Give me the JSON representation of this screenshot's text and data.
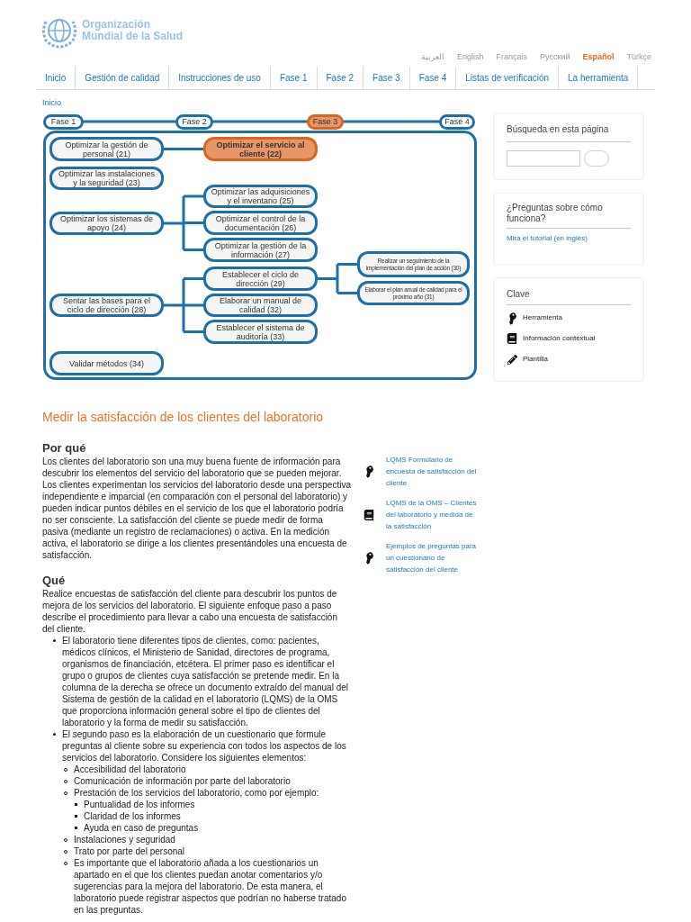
{
  "header": {
    "logo_text": [
      "Organización",
      "Mundial de la Salud"
    ],
    "languages": [
      {
        "label": "العربية",
        "selected": false
      },
      {
        "label": "English",
        "selected": false
      },
      {
        "label": "Français",
        "selected": false
      },
      {
        "label": "Русский",
        "selected": false
      },
      {
        "label": "Español",
        "selected": true
      },
      {
        "label": "Türkçe",
        "selected": false
      }
    ]
  },
  "nav": [
    "Inicio",
    "Gestión de calidad",
    "Instrucciones de uso",
    "Fase 1",
    "Fase 2",
    "Fase 3",
    "Fase 4",
    "Listas de verificación",
    "La herramienta"
  ],
  "breadcrumb": "Inicio",
  "diagram": {
    "phases": [
      {
        "label": "Fase 1",
        "selected": false
      },
      {
        "label": "Fase 2",
        "selected": false
      },
      {
        "label": "Fase 3",
        "selected": true
      },
      {
        "label": "Fase 4",
        "selected": false
      }
    ],
    "items": [
      {
        "label": "Optimizar la gestión de personal (21)",
        "selected": false,
        "children": [
          {
            "label": "Optimizar el servicio al cliente (22)",
            "selected": true
          }
        ]
      },
      {
        "label": "Optimizar las instalaciones y la seguridad (23)",
        "selected": false
      },
      {
        "label": "Optimizar los sistemas de apoyo (24)",
        "selected": false,
        "children": [
          {
            "label": "Optimizar las adquisiciones y el inventario (25)",
            "selected": false
          },
          {
            "label": "Optimizar el control de la documentación (26)",
            "selected": false
          },
          {
            "label": "Optimizar la gestión de la información (27)",
            "selected": false
          }
        ]
      },
      {
        "label": "Sentar las bases para el ciclo de dirección (28)",
        "selected": false,
        "children": [
          {
            "label": "Establecer el ciclo de dirección (29)",
            "selected": false,
            "children": [
              {
                "label": "Realizar un seguimiento de la implementación del plan de acción (30)",
                "selected": false
              },
              {
                "label": "Elaborar el plan anual de calidad para el próximo año (31)",
                "selected": false
              }
            ]
          },
          {
            "label": "Elaborar un manual de calidad (32)",
            "selected": false
          },
          {
            "label": "Establecer el sistema de auditoría (33)",
            "selected": false
          }
        ]
      },
      {
        "label": "Validar métodos (34)",
        "selected": false
      }
    ]
  },
  "title": "Medir la satisfacción de los clientes del laboratorio",
  "why": {
    "heading": "Por qué",
    "text": "Los clientes del laboratorio son una muy buena fuente de información para descubrir los elementos del servicio del laboratorio que se pueden mejorar. Los clientes experimentan los servicios del laboratorio desde una perspectiva independiente e imparcial (en comparación con el personal del laboratorio) y pueden indicar puntos débiles en el servicio de los que el laboratorio podría no ser consciente. La satisfacción del cliente se puede medir de forma pasiva (mediante un registro de reclamaciones) o activa. En la medición activa, el laboratorio se dirige a los clientes presentándoles una encuesta de satisfacción."
  },
  "what": {
    "heading": "Qué",
    "text": "Realice encuestas de satisfacción del cliente para descubrir los puntos de mejora de los servicios del laboratorio. El siguiente enfoque paso a paso describe el procedimiento para llevar a cabo una encuesta de satisfacción del cliente.",
    "items": [
      {
        "text": "El laboratorio tiene diferentes tipos de clientes, como: pacientes, médicos clínicos, el Ministerio de Sanidad, directores de programa, organismos de financiación, etcétera. El primer paso es identificar el grupo o grupos de clientes cuya satisfacción se pretende medir. En la columna de la derecha se ofrece un documento extraído del manual del Sistema de gestión de la calidad en el laboratorio (LQMS) de la OMS que proporciona información general sobre el tipo de clientes del laboratorio y la forma de medir su satisfacción."
      },
      {
        "text": "El segundo paso es la elaboración de un cuestionario que formule preguntas al cliente sobre su experiencia con todos los aspectos de los servicios del laboratorio. Considere los siguientes elementos:",
        "children": [
          {
            "text": "Accesibilidad del laboratorio"
          },
          {
            "text": "Comunicación de información por parte del laboratorio"
          },
          {
            "text": "Prestación de los servicios del laboratorio, como por ejemplo:",
            "children": [
              {
                "text": "Puntualidad de los informes"
              },
              {
                "text": "Claridad de los informes"
              },
              {
                "text": "Ayuda en caso de preguntas"
              }
            ]
          },
          {
            "text": "Instalaciones y seguridad"
          },
          {
            "text": "Trato por parte del personal"
          },
          {
            "text": "Es importante que el laboratorio añada a los cuestionarios un apartado en el que los clientes puedan anotar comentarios y/o sugerencias para la mejora del laboratorio. De esta manera, el laboratorio puede registrar aspectos que podrían no haberse tratado en las preguntas."
          }
        ]
      }
    ]
  },
  "resources": [
    {
      "kind": "tool",
      "label": "LQMS Formulario de encuesta de satisfacción del cliente"
    },
    {
      "kind": "info",
      "label": "LQMS de la OMS – Clientes del laboratorio y medida de la satisfacción"
    },
    {
      "kind": "tool",
      "label": "Ejemplos de preguntas para un cuestionario de satisfacción del cliente"
    }
  ],
  "sidebar": {
    "search_title": "Búsqueda en esta página",
    "help_title": "¿Preguntas sobre cómo funciona?",
    "help_link": "Mira el tutorial (en inglés)",
    "key_title": "Clave",
    "key_items": [
      {
        "kind": "tool",
        "label": "Herramienta"
      },
      {
        "kind": "info",
        "label": "Información contextual"
      },
      {
        "kind": "template",
        "label": "Plantilla"
      }
    ]
  }
}
